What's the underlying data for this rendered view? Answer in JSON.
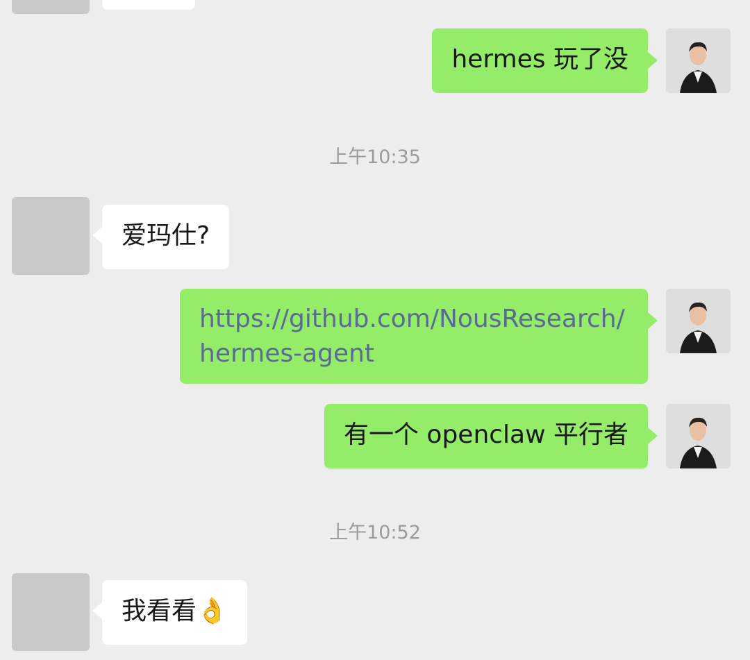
{
  "messages": [
    {
      "id": "m1",
      "from": "me",
      "text": "hermes 玩了没"
    },
    {
      "id": "m2",
      "from": "other",
      "text": "爱玛仕?"
    },
    {
      "id": "m3",
      "from": "me",
      "text": "https://github.com/NousResearch/hermes-agent"
    },
    {
      "id": "m4",
      "from": "me",
      "text": "有一个 openclaw 平行者"
    },
    {
      "id": "m5",
      "from": "other",
      "text": "我看看",
      "emoji": "👌"
    }
  ],
  "timestamps": {
    "t1": "上午10:35",
    "t2": "上午10:52"
  },
  "colors": {
    "background": "#ededed",
    "outgoing_bubble": "#95ec69",
    "incoming_bubble": "#ffffff",
    "link_text": "#576b95",
    "placeholder_avatar": "#c9c9c9"
  }
}
